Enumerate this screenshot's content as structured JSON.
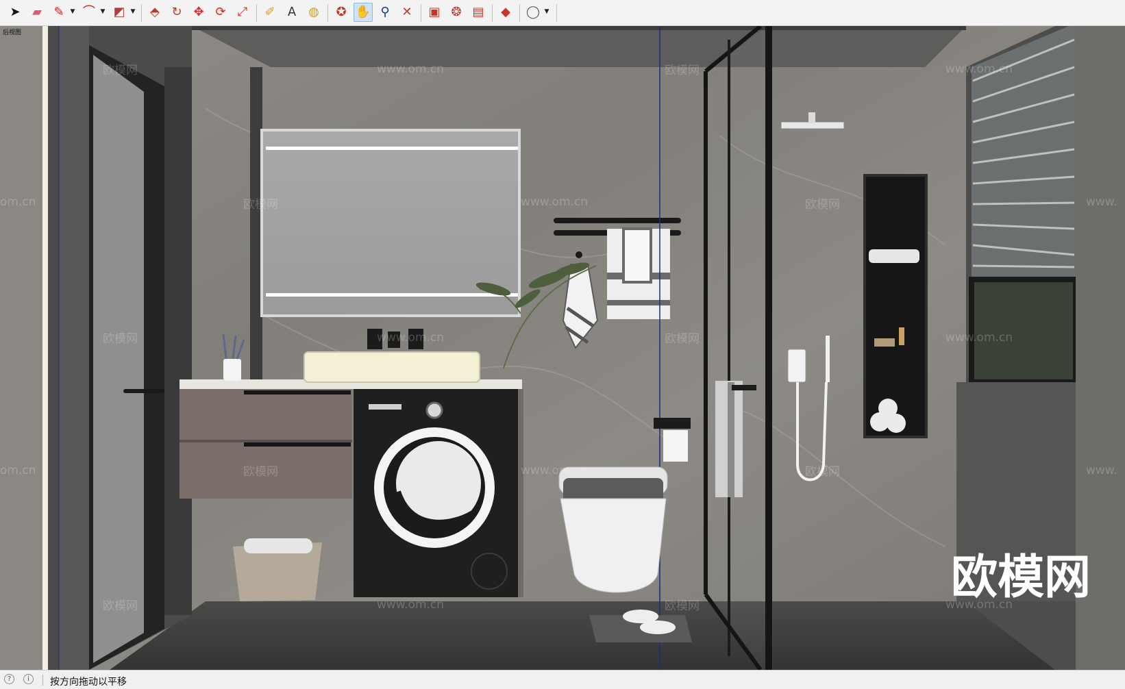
{
  "toolbar": {
    "tools": [
      {
        "name": "select-tool",
        "icon": "arrow-cursor-icon",
        "glyph": "➤",
        "color": "#111111"
      },
      {
        "name": "eraser-tool",
        "icon": "eraser-icon",
        "glyph": "▰",
        "color": "#e05a7a"
      },
      {
        "name": "line-tool",
        "icon": "pencil-icon",
        "glyph": "✎",
        "color": "#c02020"
      },
      {
        "name": "arc-tool",
        "icon": "arc-icon",
        "glyph": "⌒",
        "color": "#c02020"
      },
      {
        "name": "rectangle-tool",
        "icon": "rectangle-icon",
        "glyph": "◩",
        "color": "#b04040"
      },
      {
        "name": "push-pull-tool",
        "icon": "push-pull-icon",
        "glyph": "⬘",
        "color": "#c0392b"
      },
      {
        "name": "offset-tool",
        "icon": "offset-icon",
        "glyph": "↻",
        "color": "#c0392b"
      },
      {
        "name": "move-tool",
        "icon": "move-icon",
        "glyph": "✥",
        "color": "#d62828"
      },
      {
        "name": "rotate-tool",
        "icon": "rotate-icon",
        "glyph": "⟳",
        "color": "#d62828"
      },
      {
        "name": "scale-tool",
        "icon": "scale-icon",
        "glyph": "⤢",
        "color": "#c0392b"
      },
      {
        "name": "tape-measure-tool",
        "icon": "tape-measure-icon",
        "glyph": "✐",
        "color": "#d4a017"
      },
      {
        "name": "text-tool",
        "icon": "text-icon",
        "glyph": "A",
        "color": "#333333"
      },
      {
        "name": "paint-bucket-tool",
        "icon": "paint-bucket-icon",
        "glyph": "◍",
        "color": "#c9a227"
      },
      {
        "name": "orbit-tool",
        "icon": "orbit-icon",
        "glyph": "✪",
        "color": "#c0392b"
      },
      {
        "name": "pan-tool",
        "icon": "pan-hand-icon",
        "glyph": "✋",
        "color": "#d4a017",
        "active": true
      },
      {
        "name": "zoom-tool",
        "icon": "zoom-icon",
        "glyph": "⚲",
        "color": "#1a3a80"
      },
      {
        "name": "zoom-extents-tool",
        "icon": "zoom-extents-icon",
        "glyph": "✕",
        "color": "#c0392b"
      },
      {
        "name": "warehouse-tool",
        "icon": "warehouse-icon",
        "glyph": "▣",
        "color": "#c0392b"
      },
      {
        "name": "extension-tool",
        "icon": "extension-icon",
        "glyph": "❂",
        "color": "#c0392b"
      },
      {
        "name": "layout-tool",
        "icon": "layout-icon",
        "glyph": "▤",
        "color": "#c0392b"
      },
      {
        "name": "ruby-console-tool",
        "icon": "ruby-gem-icon",
        "glyph": "◆",
        "color": "#c0392b"
      },
      {
        "name": "account-tool",
        "icon": "user-account-icon",
        "glyph": "◯",
        "color": "#555555"
      }
    ]
  },
  "viewport": {
    "view_label": "后视图",
    "watermark_small_brand": "欧模网",
    "watermark_small_url": "www.om.cn",
    "watermark_url_fragment": "om.cn",
    "watermark_url_fragment_right": "www.",
    "watermark_large": "欧模网"
  },
  "status": {
    "text": "按方向拖动以平移"
  },
  "colors": {
    "wall_marble": "#8a8782",
    "floor": "#3a3a3a",
    "frame_dark": "#2b2b2b",
    "vanity_drawers": "#7a6f69",
    "washer": "#1f1f1f",
    "sink": "#f3f0d6",
    "guide_line": "#1a2a8a"
  }
}
